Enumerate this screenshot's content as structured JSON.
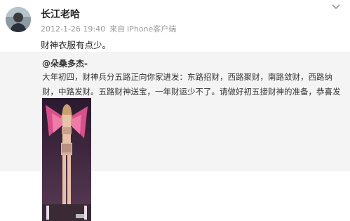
{
  "post": {
    "username": "长江老哈",
    "timestamp": "2012-1-26 19:40",
    "source_prefix": "来自",
    "source": "iPhone客户端",
    "content": "财神衣服有点少。",
    "menu_icon": "chevron-down-icon"
  },
  "repost": {
    "author": "@朵桑多杰-",
    "text": "大年初四，财神兵分五路正向你家进发：东路招财，西路聚财，南路敛财，西路纳财，中路发财。五路财神送宝，一年财运少不了。请做好初五接财神的准备，恭喜发财喔！",
    "image_icon": "runway-photo"
  }
}
